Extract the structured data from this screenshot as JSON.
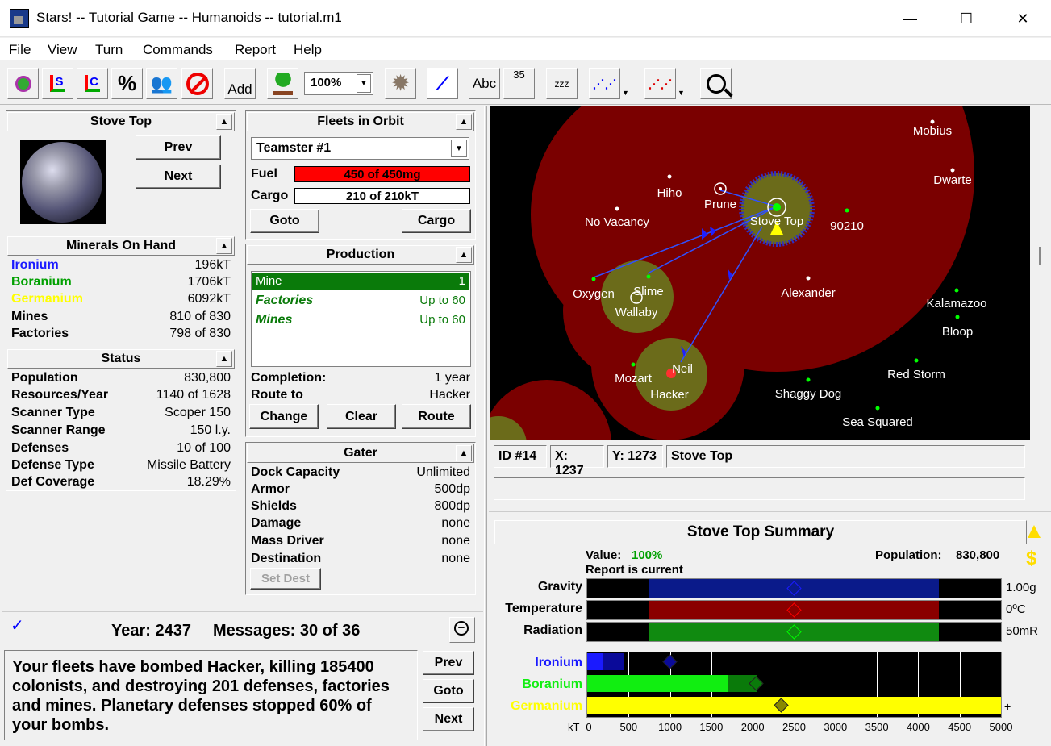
{
  "window": {
    "title": "Stars! -- Tutorial Game -- Humanoids -- tutorial.m1",
    "minimize": "—",
    "maximize": "☐",
    "close": "✕"
  },
  "menu": [
    "File",
    "View",
    "Turn",
    "Commands",
    "Report",
    "Help"
  ],
  "toolbar": {
    "add": "Add",
    "zoom": "100%",
    "pct": "%",
    "sicon": "S",
    "cicon": "C",
    "count": "35",
    "abc": "Abc",
    "zzz": "zzz"
  },
  "planet_panel": {
    "title": "Stove Top",
    "prev": "Prev",
    "next": "Next"
  },
  "minerals": {
    "title": "Minerals On Hand",
    "rows": [
      {
        "label": "Ironium",
        "value": "196kT",
        "color": "#1a1aff"
      },
      {
        "label": "Boranium",
        "value": "1706kT",
        "color": "#00a000"
      },
      {
        "label": "Germanium",
        "value": "6092kT",
        "color": "#ffff00"
      }
    ],
    "mines_label": "Mines",
    "mines_value": "810 of 830",
    "factories_label": "Factories",
    "factories_value": "798 of 830"
  },
  "status": {
    "title": "Status",
    "rows": [
      {
        "label": "Population",
        "value": "830,800"
      },
      {
        "label": "Resources/Year",
        "value": "1140 of 1628"
      },
      {
        "label": "Scanner Type",
        "value": "Scoper 150"
      },
      {
        "label": "Scanner Range",
        "value": "150 l.y."
      },
      {
        "label": "Defenses",
        "value": "10 of 100"
      },
      {
        "label": "Defense Type",
        "value": "Missile Battery"
      },
      {
        "label": "Def Coverage",
        "value": "18.29%"
      }
    ]
  },
  "fleets": {
    "title": "Fleets in Orbit",
    "selected": "Teamster #1",
    "fuel_label": "Fuel",
    "fuel_value": "450 of 450mg",
    "fuel_fill": 1.0,
    "cargo_label": "Cargo",
    "cargo_value": "210 of 210kT",
    "cargo_fill": 1.0,
    "goto": "Goto",
    "cargo_btn": "Cargo"
  },
  "production": {
    "title": "Production",
    "items": [
      {
        "name": "Mine",
        "qty": "1"
      },
      {
        "name": "Factories",
        "qty": "Up to 60"
      },
      {
        "name": "Mines",
        "qty": "Up to 60"
      }
    ],
    "completion_label": "Completion:",
    "completion_value": "1 year",
    "route_label": "Route to",
    "route_value": "Hacker",
    "change": "Change",
    "clear": "Clear",
    "route": "Route"
  },
  "gater": {
    "title": "Gater",
    "rows": [
      {
        "label": "Dock Capacity",
        "value": "Unlimited"
      },
      {
        "label": "Armor",
        "value": "500dp"
      },
      {
        "label": "Shields",
        "value": "800dp"
      },
      {
        "label": "Damage",
        "value": "none"
      },
      {
        "label": "Mass Driver",
        "value": "none"
      },
      {
        "label": "Destination",
        "value": "none"
      }
    ],
    "set_dest": "Set Dest"
  },
  "messages": {
    "year": "Year: 2437",
    "count": "Messages: 30 of 36",
    "text": "Your fleets have bombed Hacker, killing 185400 colonists, and destroying 201 defenses, factories and mines. Planetary defenses stopped 60% of your bombs.",
    "prev": "Prev",
    "goto": "Goto",
    "next": "Next"
  },
  "map_planets": [
    {
      "name": "Mobius"
    },
    {
      "name": "Dwarte"
    },
    {
      "name": "Hiho"
    },
    {
      "name": "Prune"
    },
    {
      "name": "No Vacancy"
    },
    {
      "name": "Stove Top"
    },
    {
      "name": "90210"
    },
    {
      "name": "Oxygen"
    },
    {
      "name": "Slime"
    },
    {
      "name": "Wallaby"
    },
    {
      "name": "Alexander"
    },
    {
      "name": "Kalamazoo"
    },
    {
      "name": "Bloop"
    },
    {
      "name": "Mozart"
    },
    {
      "name": "Neil"
    },
    {
      "name": "Hacker"
    },
    {
      "name": "Red Storm"
    },
    {
      "name": "Shaggy Dog"
    },
    {
      "name": "Sea Squared"
    }
  ],
  "map_status": {
    "id": "ID #14",
    "x": "X: 1237",
    "y": "Y: 1273",
    "name": "Stove Top"
  },
  "summary": {
    "title": "Stove Top Summary",
    "value_label": "Value:",
    "value": "100%",
    "population_label": "Population:",
    "population": "830,800",
    "report": "Report is current",
    "env": [
      {
        "label": "Gravity",
        "value": "1.00g",
        "color": "#0a1a8a",
        "marker": "#1a1aff",
        "range": [
          0.15,
          0.85
        ],
        "pos": 0.5
      },
      {
        "label": "Temperature",
        "value": "0ºC",
        "color": "#8a0000",
        "marker": "#ff0000",
        "range": [
          0.15,
          0.85
        ],
        "pos": 0.5
      },
      {
        "label": "Radiation",
        "value": "50mR",
        "color": "#108a10",
        "marker": "#00ff00",
        "range": [
          0.15,
          0.85
        ],
        "pos": 0.5
      }
    ],
    "minerals": [
      {
        "label": "Ironium",
        "color": "#1a1aff",
        "dark": "#0a0a99",
        "surface": 196,
        "mined": 450,
        "conc": 1000
      },
      {
        "label": "Boranium",
        "color": "#11ee11",
        "dark": "#0a7a0a",
        "surface": 1706,
        "mined": 2050,
        "conc": 2050
      },
      {
        "label": "Germanium",
        "color": "#ffff00",
        "dark": "#888800",
        "surface": 5000,
        "mined": 5000,
        "conc": 2350
      }
    ],
    "overflow": "+",
    "axis_unit": "kT",
    "axis": [
      "0",
      "500",
      "1000",
      "1500",
      "2000",
      "2500",
      "3000",
      "3500",
      "4000",
      "4500",
      "5000"
    ]
  }
}
